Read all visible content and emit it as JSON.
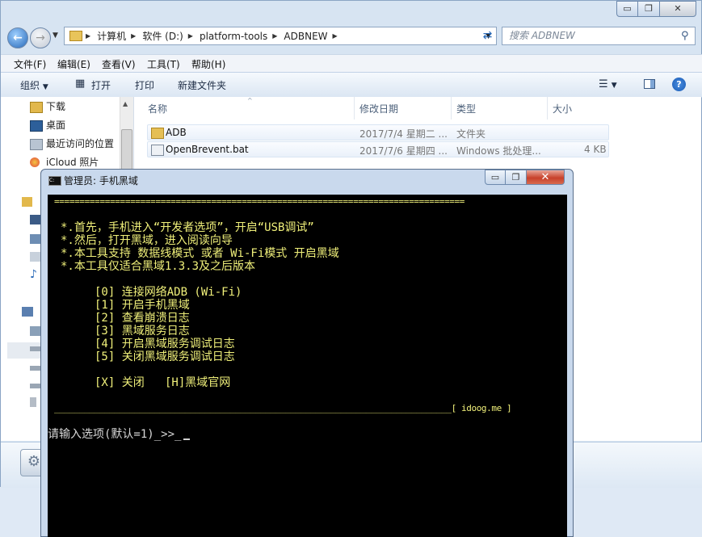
{
  "explorer": {
    "window_controls": {
      "minimize": "▭",
      "maximize": "❐",
      "close": "✕"
    },
    "breadcrumb": [
      "计算机",
      "软件 (D:)",
      "platform-tools",
      "ADBNEW"
    ],
    "search_placeholder": "搜索 ADBNEW",
    "menu": [
      "文件(F)",
      "编辑(E)",
      "查看(V)",
      "工具(T)",
      "帮助(H)"
    ],
    "commands": {
      "organize": "组织",
      "open": "打开",
      "print": "打印",
      "new_folder": "新建文件夹"
    },
    "nav": [
      "下载",
      "桌面",
      "最近访问的位置",
      "iCloud 照片"
    ],
    "columns": {
      "name": "名称",
      "modified": "修改日期",
      "type": "类型",
      "size": "大小"
    },
    "files": [
      {
        "name": "ADB",
        "modified": "2017/7/4 星期二 ...",
        "type": "文件夹",
        "size": ""
      },
      {
        "name": "OpenBrevent.bat",
        "modified": "2017/7/6 星期四 ...",
        "type": "Windows 批处理...",
        "size": "4 KB"
      }
    ],
    "colors": {
      "chrome": "#d7e4f2",
      "accent": "#2768b8"
    }
  },
  "cmd": {
    "title": "管理员: 手机黑域",
    "window_controls": {
      "minimize": "▭",
      "maximize": "❐",
      "close": "✕"
    },
    "separator": "=================================================================================",
    "intro": [
      "*.首先，手机进入“开发者选项”，开启“USB调试”",
      "*.然后，打开黑域，进入阅读向导",
      "*.本工具支持 数据线模式 或者 Wi-Fi模式 开启黑域",
      "*.本工具仅适合黑域1.3.3及之后版本"
    ],
    "options": [
      "[0] 连接网络ADB (Wi-Fi)",
      "[1] 开启手机黑域",
      "[2] 查看崩溃日志",
      "[3] 黑域服务日志",
      "[4] 开启黑域服务调试日志",
      "[5] 关闭黑域服务调试日志"
    ],
    "bottom_options": "[X] 关闭   [H]黑域官网",
    "footer": "_______________________________________________________________________________[ idoog.me ]",
    "prompt": "请输入选项(默认=1)_>>_",
    "colors": {
      "text": "#f0f07a",
      "background": "#000000"
    }
  }
}
